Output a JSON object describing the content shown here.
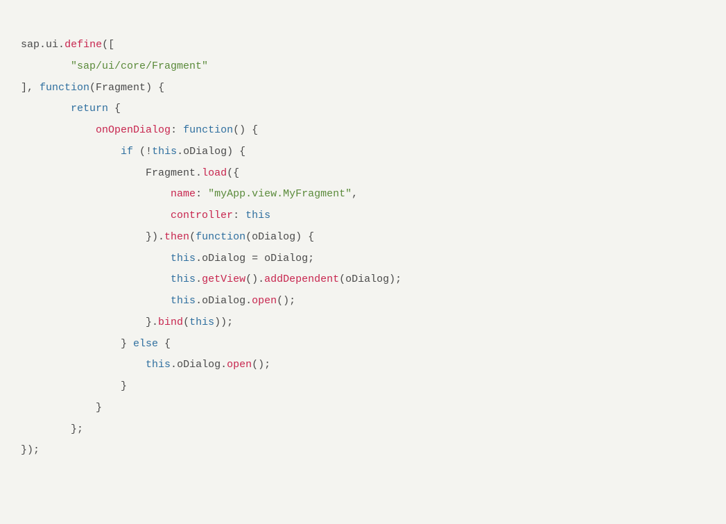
{
  "code": {
    "lines": [
      [
        {
          "t": "sap",
          "c": "tok-ident"
        },
        {
          "t": ".",
          "c": "tok-punct"
        },
        {
          "t": "ui",
          "c": "tok-ident"
        },
        {
          "t": ".",
          "c": "tok-punct"
        },
        {
          "t": "define",
          "c": "tok-method"
        },
        {
          "t": "([",
          "c": "tok-punct"
        }
      ],
      [
        {
          "t": "        ",
          "c": "tok-default"
        },
        {
          "t": "\"sap/ui/core/Fragment\"",
          "c": "tok-string"
        }
      ],
      [
        {
          "t": "], ",
          "c": "tok-punct"
        },
        {
          "t": "function",
          "c": "tok-keyword"
        },
        {
          "t": "(",
          "c": "tok-punct"
        },
        {
          "t": "Fragment",
          "c": "tok-ident"
        },
        {
          "t": ") {",
          "c": "tok-punct"
        }
      ],
      [
        {
          "t": "        ",
          "c": "tok-default"
        },
        {
          "t": "return",
          "c": "tok-keyword"
        },
        {
          "t": " {",
          "c": "tok-punct"
        }
      ],
      [
        {
          "t": "            ",
          "c": "tok-default"
        },
        {
          "t": "onOpenDialog",
          "c": "tok-prop"
        },
        {
          "t": ": ",
          "c": "tok-punct"
        },
        {
          "t": "function",
          "c": "tok-keyword"
        },
        {
          "t": "() {",
          "c": "tok-punct"
        }
      ],
      [
        {
          "t": "                ",
          "c": "tok-default"
        },
        {
          "t": "if",
          "c": "tok-keyword"
        },
        {
          "t": " (!",
          "c": "tok-punct"
        },
        {
          "t": "this",
          "c": "tok-keyword"
        },
        {
          "t": ".",
          "c": "tok-punct"
        },
        {
          "t": "oDialog",
          "c": "tok-ident"
        },
        {
          "t": ") {",
          "c": "tok-punct"
        }
      ],
      [
        {
          "t": "                    ",
          "c": "tok-default"
        },
        {
          "t": "Fragment",
          "c": "tok-ident"
        },
        {
          "t": ".",
          "c": "tok-punct"
        },
        {
          "t": "load",
          "c": "tok-method"
        },
        {
          "t": "({",
          "c": "tok-punct"
        }
      ],
      [
        {
          "t": "                        ",
          "c": "tok-default"
        },
        {
          "t": "name",
          "c": "tok-prop"
        },
        {
          "t": ": ",
          "c": "tok-punct"
        },
        {
          "t": "\"myApp.view.MyFragment\"",
          "c": "tok-string"
        },
        {
          "t": ",",
          "c": "tok-punct"
        }
      ],
      [
        {
          "t": "                        ",
          "c": "tok-default"
        },
        {
          "t": "controller",
          "c": "tok-prop"
        },
        {
          "t": ": ",
          "c": "tok-punct"
        },
        {
          "t": "this",
          "c": "tok-keyword"
        }
      ],
      [
        {
          "t": "                    }).",
          "c": "tok-punct"
        },
        {
          "t": "then",
          "c": "tok-method"
        },
        {
          "t": "(",
          "c": "tok-punct"
        },
        {
          "t": "function",
          "c": "tok-keyword"
        },
        {
          "t": "(",
          "c": "tok-punct"
        },
        {
          "t": "oDialog",
          "c": "tok-ident"
        },
        {
          "t": ") {",
          "c": "tok-punct"
        }
      ],
      [
        {
          "t": "                        ",
          "c": "tok-default"
        },
        {
          "t": "this",
          "c": "tok-keyword"
        },
        {
          "t": ".",
          "c": "tok-punct"
        },
        {
          "t": "oDialog",
          "c": "tok-ident"
        },
        {
          "t": " = ",
          "c": "tok-op"
        },
        {
          "t": "oDialog",
          "c": "tok-ident"
        },
        {
          "t": ";",
          "c": "tok-punct"
        }
      ],
      [
        {
          "t": "                        ",
          "c": "tok-default"
        },
        {
          "t": "this",
          "c": "tok-keyword"
        },
        {
          "t": ".",
          "c": "tok-punct"
        },
        {
          "t": "getView",
          "c": "tok-method"
        },
        {
          "t": "().",
          "c": "tok-punct"
        },
        {
          "t": "addDependent",
          "c": "tok-method"
        },
        {
          "t": "(",
          "c": "tok-punct"
        },
        {
          "t": "oDialog",
          "c": "tok-ident"
        },
        {
          "t": ");",
          "c": "tok-punct"
        }
      ],
      [
        {
          "t": "                        ",
          "c": "tok-default"
        },
        {
          "t": "this",
          "c": "tok-keyword"
        },
        {
          "t": ".",
          "c": "tok-punct"
        },
        {
          "t": "oDialog",
          "c": "tok-ident"
        },
        {
          "t": ".",
          "c": "tok-punct"
        },
        {
          "t": "open",
          "c": "tok-method"
        },
        {
          "t": "();",
          "c": "tok-punct"
        }
      ],
      [
        {
          "t": "                    }.",
          "c": "tok-punct"
        },
        {
          "t": "bind",
          "c": "tok-method"
        },
        {
          "t": "(",
          "c": "tok-punct"
        },
        {
          "t": "this",
          "c": "tok-keyword"
        },
        {
          "t": "));",
          "c": "tok-punct"
        }
      ],
      [
        {
          "t": "                } ",
          "c": "tok-punct"
        },
        {
          "t": "else",
          "c": "tok-keyword"
        },
        {
          "t": " {",
          "c": "tok-punct"
        }
      ],
      [
        {
          "t": "                    ",
          "c": "tok-default"
        },
        {
          "t": "this",
          "c": "tok-keyword"
        },
        {
          "t": ".",
          "c": "tok-punct"
        },
        {
          "t": "oDialog",
          "c": "tok-ident"
        },
        {
          "t": ".",
          "c": "tok-punct"
        },
        {
          "t": "open",
          "c": "tok-method"
        },
        {
          "t": "();",
          "c": "tok-punct"
        }
      ],
      [
        {
          "t": "                }",
          "c": "tok-punct"
        }
      ],
      [
        {
          "t": "            }",
          "c": "tok-punct"
        }
      ],
      [
        {
          "t": "        };",
          "c": "tok-punct"
        }
      ],
      [
        {
          "t": "});",
          "c": "tok-punct"
        }
      ]
    ]
  }
}
